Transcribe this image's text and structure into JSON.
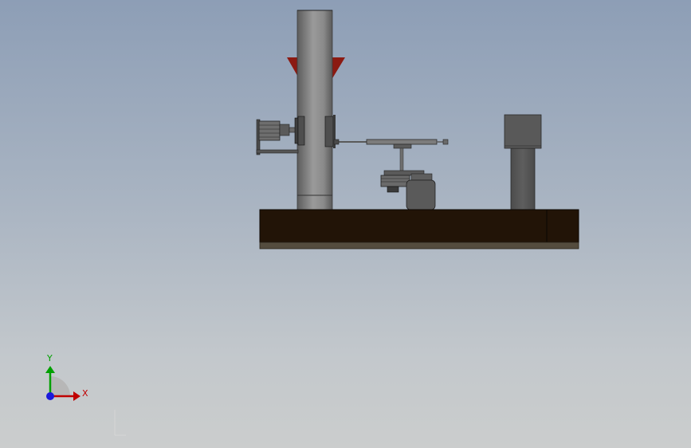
{
  "viewport": {
    "background_top": "#8d9eb6",
    "background_bottom": "#cbcdcd"
  },
  "colors": {
    "column": "#7a7a7a",
    "funnel": "#8b1a12",
    "base_top": "#221407",
    "base_bottom": "#544c3e",
    "motor_body": "#5a5a5a",
    "box": "#545454",
    "axis_x": "#c00000",
    "axis_y": "#00a000",
    "axis_z": "#1a1adb"
  },
  "orientation_triad": {
    "x_label": "X",
    "y_label": "Y",
    "icon": "coordinate-triad-icon"
  }
}
